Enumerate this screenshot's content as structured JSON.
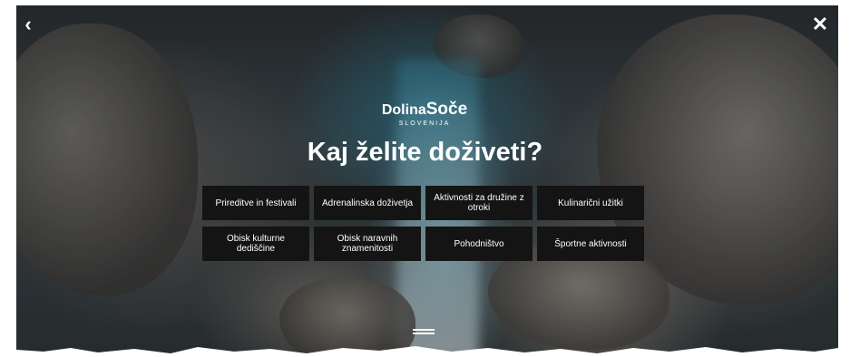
{
  "nav": {
    "back_icon": "‹",
    "close_icon": "✕"
  },
  "logo": {
    "dolina": "Dolina",
    "soce": "Soče",
    "country": "SLOVENIJA"
  },
  "heading": "Kaj želite doživeti?",
  "categories": [
    "Prireditve in festivali",
    "Adrenalinska doživetja",
    "Aktivnosti za družine z otroki",
    "Kulinarični užitki",
    "Obisk kulturne dediščine",
    "Obisk naravnih znamenitosti",
    "Pohodništvo",
    "Športne aktivnosti"
  ],
  "colors": {
    "button_bg": "#141414",
    "text": "#ffffff",
    "page_bg": "#ffffff"
  }
}
